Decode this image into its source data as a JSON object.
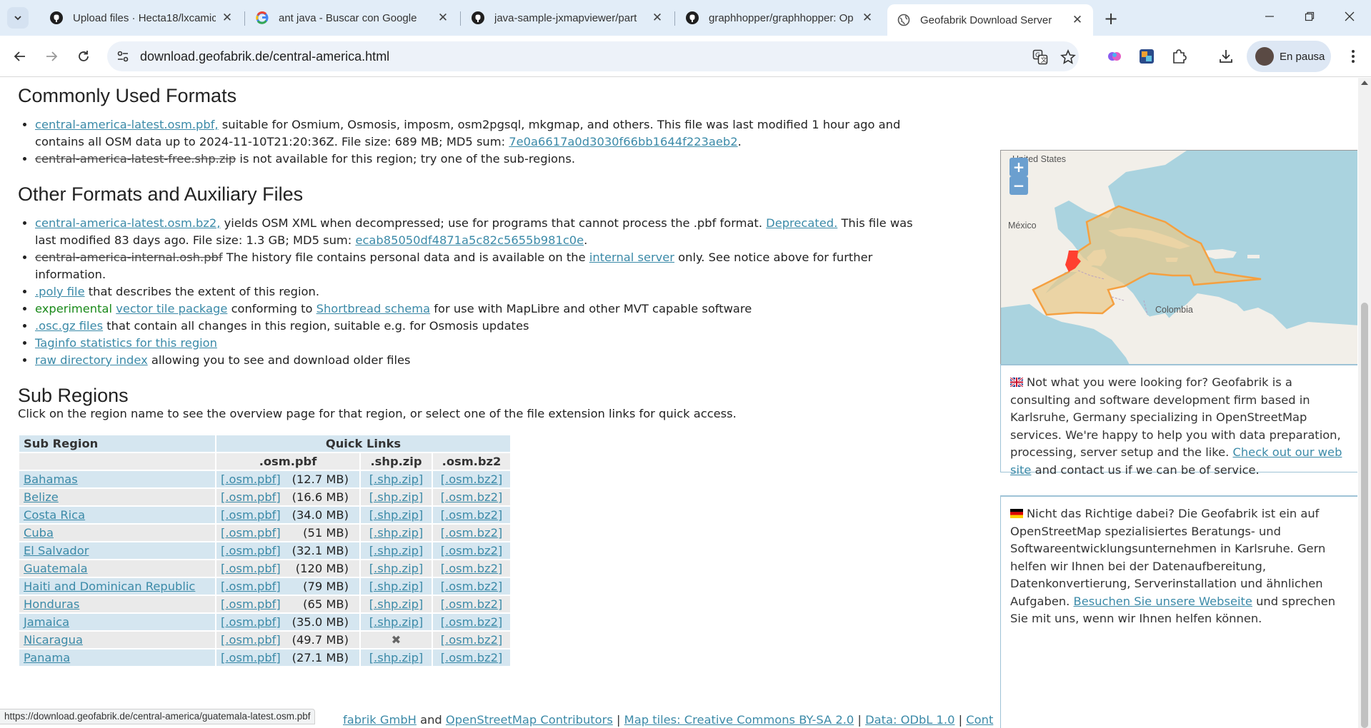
{
  "browser": {
    "tabs": [
      {
        "title": "Upload files · Hecta18/lxcamicP",
        "favicon": "github-icon"
      },
      {
        "title": "ant java - Buscar con Google",
        "favicon": "google-icon"
      },
      {
        "title": "java-sample-jxmapviewer/part",
        "favicon": "github-icon"
      },
      {
        "title": "graphhopper/graphhopper: Op",
        "favicon": "github-icon"
      },
      {
        "title": "Geofabrik Download Server",
        "favicon": "globe-icon",
        "active": true
      }
    ],
    "url": "download.geofabrik.de/central-america.html",
    "profile_label": "En pausa",
    "status_url": "https://download.geofabrik.de/central-america/guatemala-latest.osm.pbf"
  },
  "formats": {
    "heading": "Commonly Used Formats",
    "item1": {
      "link": "central-america-latest.osm.pbf,",
      "text": " suitable for Osmium, Osmosis, imposm, osm2pgsql, mkgmap, and others. This file was last modified 1 hour ago and contains all OSM data up to 2024-11-10T21:20:36Z. File size: 689 MB; MD5 sum: ",
      "md5": "7e0a6617a0d3030f66bb1644f223aeb2",
      "end": "."
    },
    "item2": {
      "strike": "central-america-latest-free.shp.zip",
      "text": " is not available for this region; try one of the sub-regions."
    }
  },
  "other": {
    "heading": "Other Formats and Auxiliary Files",
    "bz2_link": "central-america-latest.osm.bz2,",
    "bz2_text1": " yields OSM XML when decompressed; use for programs that cannot process the .pbf format. ",
    "bz2_deprecated": "Deprecated.",
    "bz2_text2": " This file was last modified 83 days ago. File size: 1.3 GB; MD5 sum: ",
    "bz2_md5": "ecab85050df4871a5c82c5655b981c0e",
    "bz2_end": ".",
    "history_strike": "central-america-internal.osh.pbf",
    "history_text1": " The history file contains personal data and is available on the ",
    "history_link": "internal server",
    "history_text2": " only. See notice above for further information.",
    "poly_link": ".poly file",
    "poly_text": " that describes the extent of this region.",
    "exp_label": "experimental",
    "vector_link": "vector tile package",
    "vector_text1": " conforming to ",
    "shortbread_link": "Shortbread schema",
    "vector_text2": " for use with MapLibre and other MVT capable software",
    "osc_link": ".osc.gz files",
    "osc_text": " that contain all changes in this region, suitable e.g. for Osmosis updates",
    "taginfo_link": "Taginfo statistics for this region",
    "raw_link": "raw directory index",
    "raw_text": " allowing you to see and download older files"
  },
  "subregions": {
    "heading": "Sub Regions",
    "description": "Click on the region name to see the overview page for that region, or select one of the file extension links for quick access.",
    "header_region": "Sub Region",
    "header_quick": "Quick Links",
    "col_pbf": ".osm.pbf",
    "col_shp": ".shp.zip",
    "col_bz2": ".osm.bz2",
    "pbf_label": "[.osm.pbf]",
    "shp_label": "[.shp.zip]",
    "bz2_label": "[.osm.bz2]",
    "unavailable_mark": "✖",
    "rows": [
      {
        "name": "Bahamas",
        "size": "(12.7 MB)",
        "shp": true
      },
      {
        "name": "Belize",
        "size": "(16.6 MB)",
        "shp": true
      },
      {
        "name": "Costa Rica",
        "size": "(34.0 MB)",
        "shp": true
      },
      {
        "name": "Cuba",
        "size": "(51 MB)",
        "shp": true
      },
      {
        "name": "El Salvador",
        "size": "(32.1 MB)",
        "shp": true
      },
      {
        "name": "Guatemala",
        "size": "(120 MB)",
        "shp": true
      },
      {
        "name": "Haiti and Dominican Republic",
        "size": "(79 MB)",
        "shp": true
      },
      {
        "name": "Honduras",
        "size": "(65 MB)",
        "shp": true
      },
      {
        "name": "Jamaica",
        "size": "(35.0 MB)",
        "shp": true
      },
      {
        "name": "Nicaragua",
        "size": "(49.7 MB)",
        "shp": false
      },
      {
        "name": "Panama",
        "size": "(27.1 MB)",
        "shp": true
      }
    ]
  },
  "map": {
    "label_us": "United States",
    "label_mexico": "México",
    "label_colombia": "Colombia",
    "zoom_in": "+",
    "zoom_out": "−",
    "region_fill": "#e8c98a",
    "region_stroke": "#f5a040",
    "highlight": "#ff4030"
  },
  "info_en": {
    "text": "Not what you were looking for? Geofabrik is a consulting and software development firm based in Karlsruhe, Germany specializing in OpenStreetMap services. We're happy to help you with data preparation, processing, server setup and the like. ",
    "link": "Check out our web site",
    "end": " and contact us if we can be of service."
  },
  "info_de": {
    "text": "Nicht das Richtige dabei? Die Geofabrik ist ein auf OpenStreetMap spezialisiertes Beratungs- und Softwareentwicklungsunternehmen in Karlsruhe. Gern helfen wir Ihnen bei der Datenaufbereitung, Datenkonvertierung, Serverinstallation und ähnlichen Aufgaben. ",
    "link": "Besuchen Sie unsere Webseite",
    "end": " und sprechen Sie mit uns, wenn wir Ihnen helfen können."
  },
  "footer": {
    "link1": "fabrik GmbH",
    "and": " and ",
    "link2": "OpenStreetMap Contributors",
    "sep": " | ",
    "link3": "Map tiles: Creative Commons BY-SA 2.0",
    "link4": "Data: ODbL 1.0",
    "link5": "Cont"
  }
}
